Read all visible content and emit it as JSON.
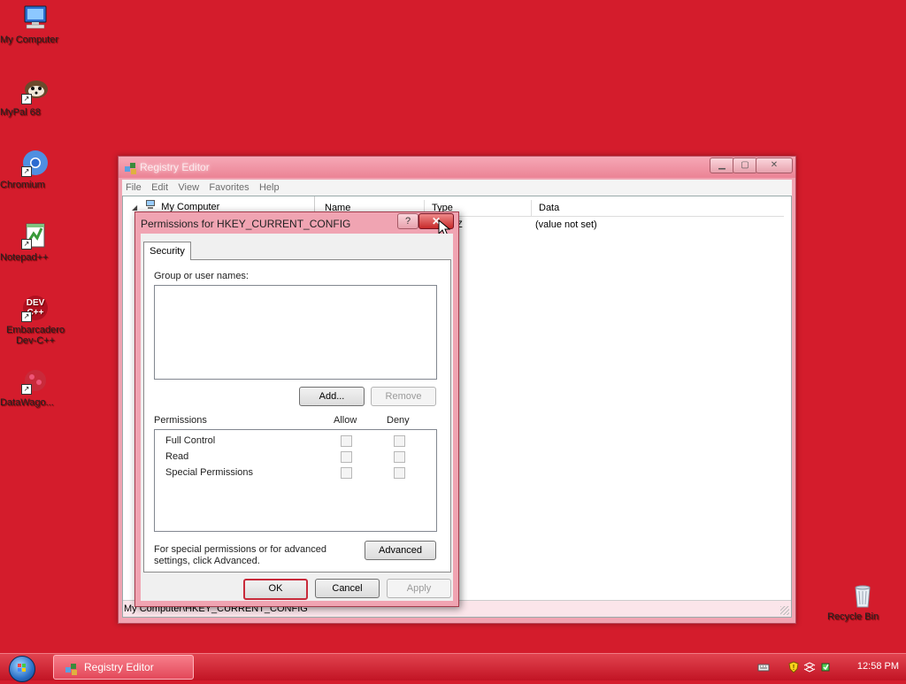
{
  "desktop": {
    "icons": [
      {
        "label": "My Computer"
      },
      {
        "label": "MyPal 68"
      },
      {
        "label": "Chromium"
      },
      {
        "label": "Notepad++"
      },
      {
        "label": "Embarcadero Dev-C++"
      },
      {
        "label": "DataWago..."
      },
      {
        "label": "Recycle Bin"
      }
    ]
  },
  "registry_editor": {
    "title": "Registry Editor",
    "menu": [
      "File",
      "Edit",
      "View",
      "Favorites",
      "Help"
    ],
    "tree_root": "My Computer",
    "columns": [
      "Name",
      "Type",
      "Data"
    ],
    "row": {
      "type_fragment": "Z",
      "data": "(value not set)"
    },
    "status": "My Computer\\HKEY_CURRENT_CONFIG"
  },
  "permissions_dialog": {
    "title": "Permissions for HKEY_CURRENT_CONFIG",
    "help_glyph": "?",
    "close_glyph": "✕",
    "tab": "Security",
    "group_label": "Group or user names:",
    "add_button": "Add...",
    "remove_button": "Remove",
    "permissions_label": "Permissions",
    "allow_label": "Allow",
    "deny_label": "Deny",
    "permissions": [
      "Full Control",
      "Read",
      "Special Permissions"
    ],
    "advanced_note": "For special permissions or for advanced settings, click Advanced.",
    "advanced_button": "Advanced",
    "ok_button": "OK",
    "cancel_button": "Cancel",
    "apply_button": "Apply"
  },
  "taskbar": {
    "task_label": "Registry Editor",
    "clock": "12:58 PM"
  },
  "colors": {
    "desktop": "#d41c2c",
    "window_frame": "#f0a4b2",
    "close_button": "#c72a2a",
    "default_button_border": "#c82a3a"
  }
}
